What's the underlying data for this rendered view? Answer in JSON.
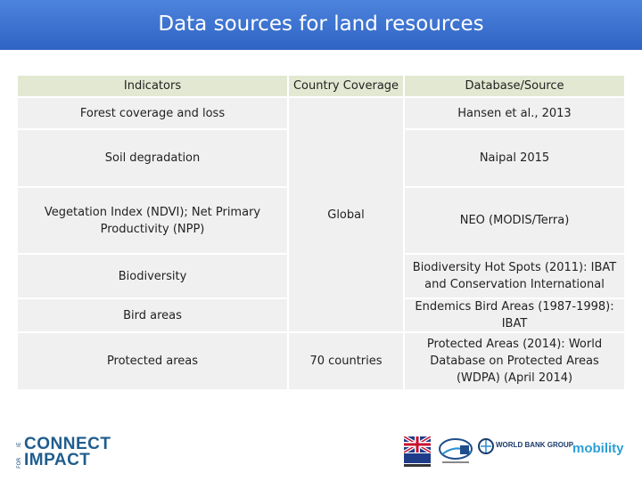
{
  "title": "Data sources for land resources",
  "table": {
    "headers": [
      "Indicators",
      "Country Coverage",
      "Database/Source"
    ],
    "indicators": [
      "Forest coverage and loss",
      "Soil degradation",
      "Vegetation Index (NDVI); Net Primary Productivity (NPP)",
      "Biodiversity",
      "Bird areas",
      "Protected areas"
    ],
    "coverage": [
      "Global",
      "70 countries"
    ],
    "sources": [
      "Hansen et al., 2013",
      "Naipal 2015",
      "NEO (MODIS/Terra)",
      "Biodiversity Hot Spots (2011): IBAT and Conservation International",
      "Endemics Bird Areas (1987-1998): IBAT",
      "Protected Areas (2014): World Database on Protected Areas (WDPA) (April 2014)"
    ]
  },
  "logos": {
    "connect_small": "IE",
    "connect_small_2": "FOR",
    "connect_line1": "CONNECT",
    "connect_line2": "IMPACT",
    "worldbank": "WORLD BANK GROUP",
    "mobility": "mobility"
  },
  "colors": {
    "title_bar": "#3a6fd0",
    "header_row": "#e3e8d2",
    "cell": "#f0f0f0"
  }
}
